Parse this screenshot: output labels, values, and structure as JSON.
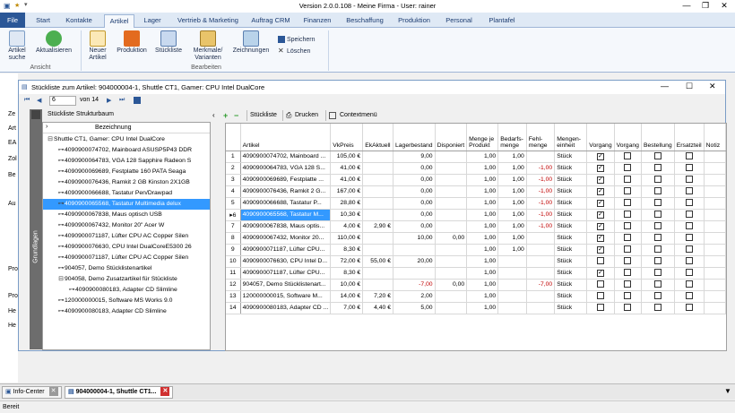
{
  "app": {
    "title": "Version 2.0.0.108 - Meine Firma - User: rainer",
    "minimize": "—",
    "restore": "❐",
    "close": "✕"
  },
  "ribbon_tabs": [
    "File",
    "Start",
    "Kontakte",
    "Artikel",
    "Lager",
    "Vertrieb & Marketing",
    "Auftrag CRM",
    "Finanzen",
    "Beschaffung",
    "Produktion",
    "Personal",
    "Plantafel"
  ],
  "ribbon": {
    "artikel_suche": "Artikel suche",
    "aktualisieren": "Aktualisieren",
    "group_ansicht": "Ansicht",
    "neuer_artikel": "Neuer Artikel",
    "produktion": "Produktion",
    "stueckliste": "Stückliste",
    "merkmale": "Merkmale/ Varianten",
    "zeichnungen": "Zeichnungen",
    "speichern": "Speichern",
    "loeschen": "Löschen",
    "group_bearbeiten": "Bearbeiten"
  },
  "bg_labels": [
    "Ze",
    "Art",
    "EA",
    "Zol",
    "Be",
    "Au",
    "Pro",
    "Pro",
    "He",
    "He"
  ],
  "window": {
    "title": "Stückliste zum Artikel: 904000004-1, Shuttle CT1, Gamer: CPU Intel DualCore",
    "record": "6",
    "of_label": "von 14"
  },
  "left_panel": {
    "title": "Stückliste Strukturbaum",
    "side_tab": "Grundlagen",
    "column": "Bezeichnung",
    "tree": [
      "Shuttle CT1, Gamer: CPU Intel DualCore",
      "4090900074702, Mainboard ASUSP5P43 DDR",
      "4090900064783, VGA 128 Sapphire Radeon S",
      "4090900069689, Festplatte 160 PATA Seaga",
      "4090900076436, Ramkit 2 GB Kinston 2X1GB",
      "4090900066688, Tastatur Pen/Drawpad",
      "4090900065568, Tastatur Multimedia delux",
      "4090900067838, Maus optisch USB",
      "4090900067432, Monitor 20\" Acer W",
      "4090900071187, Lüfter CPU AC Copper Silen",
      "4090900076630, CPU Intel DualCoreE5300 26",
      "4090900071187, Lüfter CPU AC Copper Silen",
      "904057, Demo Stücklistenartikel",
      "904058, Demo Zusatzartikel für Stückliste",
      "4090900080183, Adapter CD Slimline",
      "120000000015, Software MS Works 9.0",
      "4090900080183, Adapter CD Slimline"
    ]
  },
  "toolbar": {
    "stueckliste": "Stückliste",
    "drucken": "Drucken",
    "contextmenu": "Contextmenü"
  },
  "grid": {
    "headers": [
      "Artikel",
      "VkPreis",
      "EkAktuell",
      "Lagerbestand",
      "Disponiert",
      "Menge je Produkt",
      "Bedarfs-menge",
      "Fehl-menge",
      "Mengen-einheit",
      "Vorgang",
      "Vorgang",
      "Bestellung",
      "Ersatzteil",
      "Notiz"
    ],
    "rows": [
      {
        "n": "1",
        "artikel": "4090900074702, Mainboard ...",
        "vk": "105,00 €",
        "ek": "",
        "lager": "9,00",
        "dispo": "",
        "menge": "1,00",
        "bedarf": "1,00",
        "fehl": "",
        "einheit": "Stück",
        "c1": true,
        "c2": false,
        "c3": false,
        "c4": false
      },
      {
        "n": "2",
        "artikel": "4090900064783, VGA 128 S...",
        "vk": "41,00 €",
        "ek": "",
        "lager": "0,00",
        "dispo": "",
        "menge": "1,00",
        "bedarf": "1,00",
        "fehl": "-1,00",
        "einheit": "Stück",
        "c1": true,
        "c2": false,
        "c3": false,
        "c4": false
      },
      {
        "n": "3",
        "artikel": "4090900069689, Festplatte ...",
        "vk": "41,00 €",
        "ek": "",
        "lager": "0,00",
        "dispo": "",
        "menge": "1,00",
        "bedarf": "1,00",
        "fehl": "-1,00",
        "einheit": "Stück",
        "c1": true,
        "c2": false,
        "c3": false,
        "c4": false
      },
      {
        "n": "4",
        "artikel": "4090900076436, Ramkit 2 G...",
        "vk": "167,00 €",
        "ek": "",
        "lager": "0,00",
        "dispo": "",
        "menge": "1,00",
        "bedarf": "1,00",
        "fehl": "-1,00",
        "einheit": "Stück",
        "c1": true,
        "c2": false,
        "c3": false,
        "c4": false
      },
      {
        "n": "5",
        "artikel": "4090900066688, Tastatur P...",
        "vk": "28,80 €",
        "ek": "",
        "lager": "0,00",
        "dispo": "",
        "menge": "1,00",
        "bedarf": "1,00",
        "fehl": "-1,00",
        "einheit": "Stück",
        "c1": true,
        "c2": false,
        "c3": false,
        "c4": false
      },
      {
        "n": "6",
        "artikel": "4090900065568, Tastatur M...",
        "vk": "10,30 €",
        "ek": "",
        "lager": "0,00",
        "dispo": "",
        "menge": "1,00",
        "bedarf": "1,00",
        "fehl": "-1,00",
        "einheit": "Stück",
        "c1": true,
        "c2": false,
        "c3": false,
        "c4": false,
        "sel": true
      },
      {
        "n": "7",
        "artikel": "4090900067838, Maus optis...",
        "vk": "4,00 €",
        "ek": "2,90 €",
        "lager": "0,00",
        "dispo": "",
        "menge": "1,00",
        "bedarf": "1,00",
        "fehl": "-1,00",
        "einheit": "Stück",
        "c1": true,
        "c2": false,
        "c3": false,
        "c4": false
      },
      {
        "n": "8",
        "artikel": "4090900067432, Monitor 20...",
        "vk": "110,00 €",
        "ek": "",
        "lager": "10,00",
        "dispo": "0,00",
        "menge": "1,00",
        "bedarf": "1,00",
        "fehl": "",
        "einheit": "Stück",
        "c1": true,
        "c2": false,
        "c3": false,
        "c4": false
      },
      {
        "n": "9",
        "artikel": "4090900071187, Lüfter CPU...",
        "vk": "8,30 €",
        "ek": "",
        "lager": "",
        "dispo": "",
        "menge": "1,00",
        "bedarf": "1,00",
        "fehl": "",
        "einheit": "Stück",
        "c1": true,
        "c2": false,
        "c3": false,
        "c4": false
      },
      {
        "n": "10",
        "artikel": "4090900076630, CPU Intel D...",
        "vk": "72,00 €",
        "ek": "55,00 €",
        "lager": "20,00",
        "dispo": "",
        "menge": "1,00",
        "bedarf": "",
        "fehl": "",
        "einheit": "Stück",
        "c1": false,
        "c2": false,
        "c3": false,
        "c4": false
      },
      {
        "n": "11",
        "artikel": "4090900071187, Lüfter CPU...",
        "vk": "8,30 €",
        "ek": "",
        "lager": "",
        "dispo": "",
        "menge": "1,00",
        "bedarf": "",
        "fehl": "",
        "einheit": "Stück",
        "c1": true,
        "c2": false,
        "c3": false,
        "c4": false
      },
      {
        "n": "12",
        "artikel": "904057, Demo Stücklistenart...",
        "vk": "10,00 €",
        "ek": "",
        "lager": "-7,00",
        "dispo": "0,00",
        "menge": "1,00",
        "bedarf": "",
        "fehl": "-7,00",
        "einheit": "Stück",
        "c1": false,
        "c2": false,
        "c3": false,
        "c4": false
      },
      {
        "n": "13",
        "artikel": "120000000015, Software M...",
        "vk": "14,00 €",
        "ek": "7,20 €",
        "lager": "2,00",
        "dispo": "",
        "menge": "1,00",
        "bedarf": "",
        "fehl": "",
        "einheit": "Stück",
        "c1": false,
        "c2": false,
        "c3": false,
        "c4": false
      },
      {
        "n": "14",
        "artikel": "4090900080183, Adapter CD ...",
        "vk": "7,00 €",
        "ek": "4,40 €",
        "lager": "5,00",
        "dispo": "",
        "menge": "1,00",
        "bedarf": "",
        "fehl": "",
        "einheit": "Stück",
        "c1": false,
        "c2": false,
        "c3": false,
        "c4": false
      }
    ]
  },
  "taskbar": {
    "item1": "Info-Center",
    "item2": "904000004-1, Shuttle CT1..."
  },
  "status": "Bereit",
  "colors": {
    "accent": "#2b5797",
    "selection": "#3399ff",
    "negative": "#c00000"
  }
}
